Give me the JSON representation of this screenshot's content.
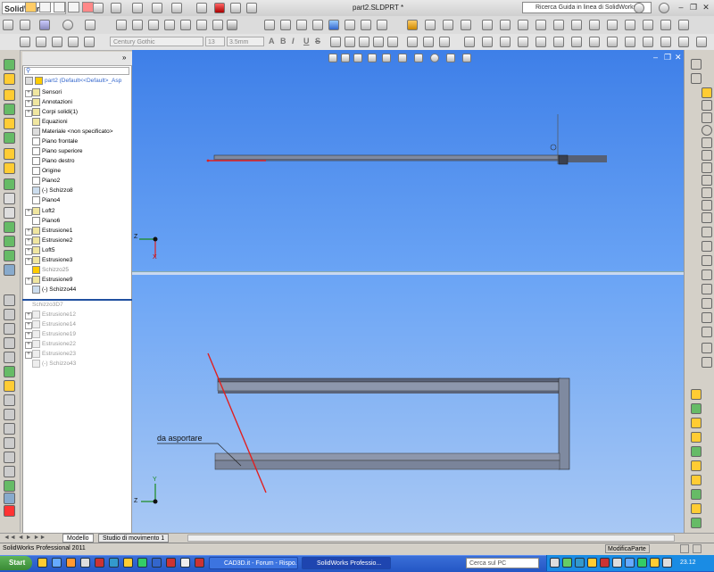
{
  "app": {
    "logo_text": "SolidWorks",
    "doc_title": "part2.SLDPRT *",
    "search_placeholder": "Ricerca Guida in linea di SolidWorks"
  },
  "formatting": {
    "font": "Century Gothic",
    "size": "13",
    "height": "3.5mm",
    "buttons": [
      "A",
      "B",
      "I",
      "U",
      "S"
    ]
  },
  "tree": {
    "root": "part2  (Default<<Default>_Asp",
    "items": [
      {
        "label": "Sensori"
      },
      {
        "label": "Annotazioni"
      },
      {
        "label": "Corpi solidi(1)"
      },
      {
        "label": "Equazioni"
      },
      {
        "label": "Materiale <non specificato>"
      },
      {
        "label": "Piano frontale"
      },
      {
        "label": "Piano superiore"
      },
      {
        "label": "Piano destro"
      },
      {
        "label": "Origine"
      },
      {
        "label": "Piano2"
      },
      {
        "label": "(-) Schizzo8"
      },
      {
        "label": "Piano4"
      },
      {
        "label": "Loft2"
      },
      {
        "label": "Piano6"
      },
      {
        "label": "Estrusione1"
      },
      {
        "label": "Estrusione2"
      },
      {
        "label": "Loft5"
      },
      {
        "label": "Estrusione3"
      },
      {
        "label": "Schizzo25"
      },
      {
        "label": "Estrusione9"
      },
      {
        "label": "(-) Schizzo44"
      },
      {
        "label": "Schizzo3D7"
      },
      {
        "label": "Estrusione12"
      },
      {
        "label": "Estrusione14"
      },
      {
        "label": "Estrusione19"
      },
      {
        "label": "Estrusione22"
      },
      {
        "label": "Estrusione23"
      },
      {
        "label": "(-) Schizzo43"
      }
    ]
  },
  "viewport": {
    "annotation": "da asportare",
    "axis_z": "Z",
    "axis_x": "X",
    "axis_y": "Y"
  },
  "tabs": [
    "Modello",
    "Studio di movimento 1"
  ],
  "status": {
    "text": "SolidWorks Professional 2011",
    "mode": "ModificaParte"
  },
  "taskbar": {
    "start": "Start",
    "tasks": [
      "CAD3D.it - Forum - Rispo...",
      "SolidWorks Professio..."
    ],
    "search": "Cerca sul PC",
    "clock": "23.12"
  }
}
